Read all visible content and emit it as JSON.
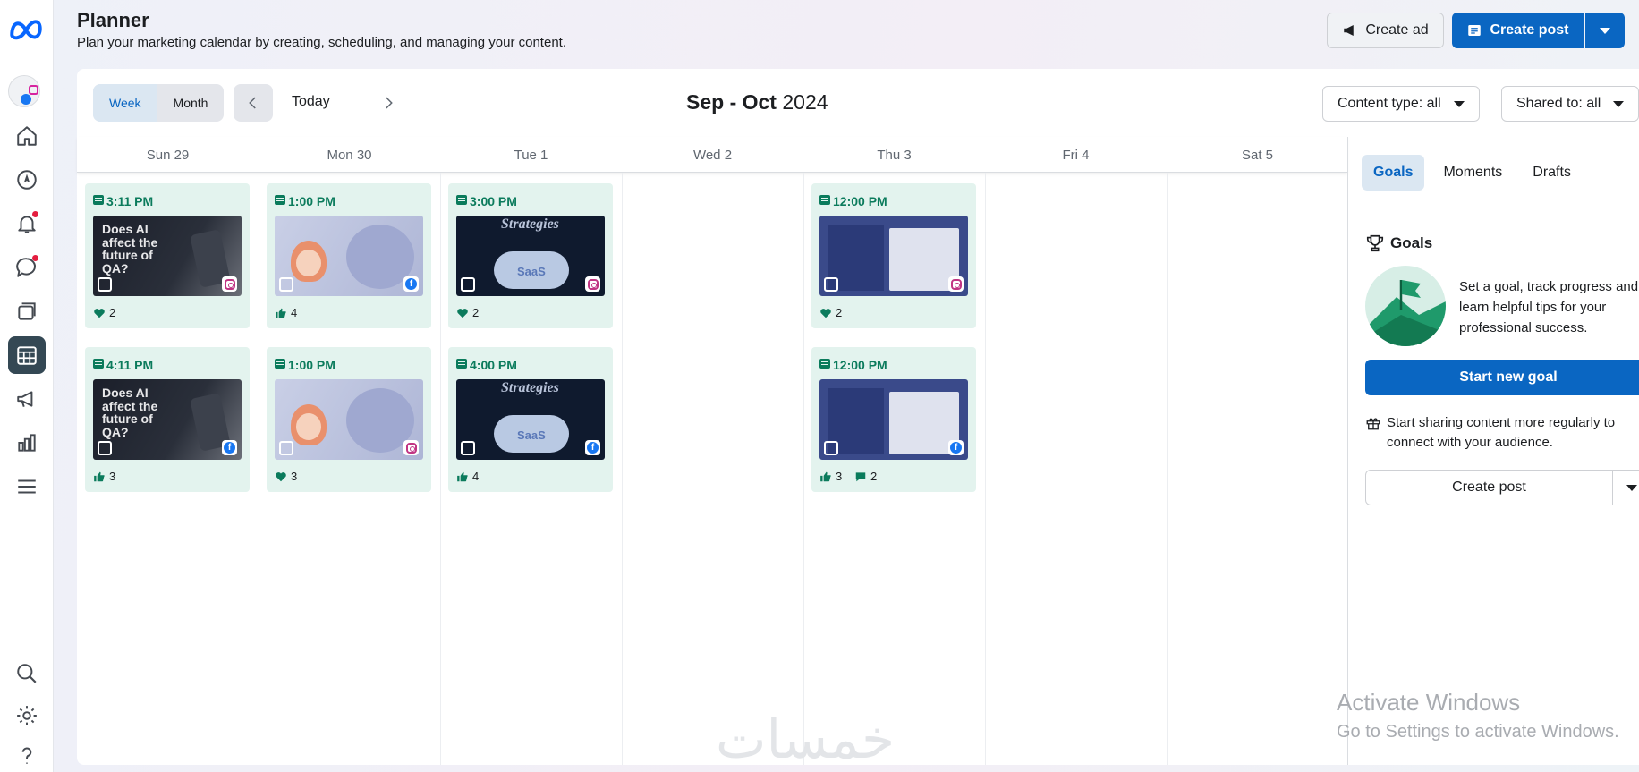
{
  "header": {
    "title": "Planner",
    "subtitle": "Plan your marketing calendar by creating, scheduling, and managing your content.",
    "create_ad_label": "Create ad",
    "create_post_label": "Create post"
  },
  "toolbar": {
    "week_label": "Week",
    "month_label": "Month",
    "today_label": "Today",
    "range_title_bold": "Sep - Oct",
    "range_title_year": "2024",
    "content_type_label": "Content type: all",
    "shared_to_label": "Shared to: all"
  },
  "days": [
    "Sun 29",
    "Mon 30",
    "Tue 1",
    "Wed 2",
    "Thu 3",
    "Fri 4",
    "Sat 5"
  ],
  "posts": [
    {
      "day": 0,
      "row": 0,
      "time": "3:11 PM",
      "network": "instagram",
      "metric_icon": "heart-icon",
      "metric": "2",
      "thumb": "ai",
      "thumb_text": "Does AI affect the future of QA?"
    },
    {
      "day": 0,
      "row": 1,
      "time": "4:11 PM",
      "network": "facebook",
      "metric_icon": "like-icon",
      "metric": "3",
      "thumb": "ai",
      "thumb_text": "Does AI affect the future of QA?"
    },
    {
      "day": 1,
      "row": 0,
      "time": "1:00 PM",
      "network": "facebook",
      "metric_icon": "like-icon",
      "metric": "4",
      "thumb": "girl",
      "thumb_text": ""
    },
    {
      "day": 1,
      "row": 1,
      "time": "1:00 PM",
      "network": "instagram",
      "metric_icon": "heart-icon",
      "metric": "3",
      "thumb": "girl",
      "thumb_text": ""
    },
    {
      "day": 2,
      "row": 0,
      "time": "3:00 PM",
      "network": "instagram",
      "metric_icon": "heart-icon",
      "metric": "2",
      "thumb": "saas",
      "thumb_text": "Strategies"
    },
    {
      "day": 2,
      "row": 1,
      "time": "4:00 PM",
      "network": "facebook",
      "metric_icon": "like-icon",
      "metric": "4",
      "thumb": "saas",
      "thumb_text": "Strategies"
    },
    {
      "day": 4,
      "row": 0,
      "time": "12:00 PM",
      "network": "instagram",
      "metric_icon": "heart-icon",
      "metric": "2",
      "thumb": "code",
      "thumb_text": ""
    },
    {
      "day": 4,
      "row": 1,
      "time": "12:00 PM",
      "network": "facebook",
      "metric_icon": "like-icon",
      "metric": "3",
      "metric2_icon": "comment-icon",
      "metric2": "2",
      "thumb": "code",
      "thumb_text": ""
    }
  ],
  "side_panel": {
    "tabs": [
      "Goals",
      "Moments",
      "Drafts"
    ],
    "goals_title": "Goals",
    "goals_desc": "Set a goal, track progress and learn helpful tips for your professional success.",
    "start_goal_label": "Start new goal",
    "tip_text": "Start sharing content more regularly to connect with your audience.",
    "create_post_label": "Create post"
  },
  "watermarks": {
    "activate_line1": "Activate Windows",
    "activate_line2": "Go to Settings to activate Windows.",
    "logo_text": "خمسات"
  },
  "colors": {
    "accent": "#0a66c2",
    "card_bg": "#e3f3ee",
    "card_time": "#0b7b5c",
    "active_rail": "#344854"
  }
}
